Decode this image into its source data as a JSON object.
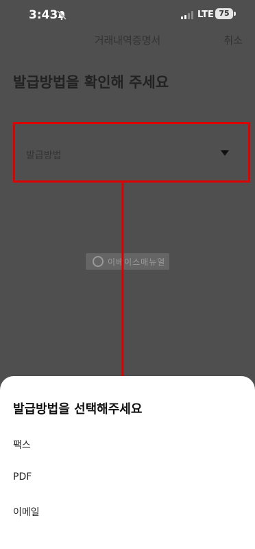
{
  "status_bar": {
    "time": "3:43",
    "network": "LTE",
    "battery": "75",
    "icons": [
      "bell-off-icon",
      "signal-icon",
      "battery-icon"
    ]
  },
  "header": {
    "title": "거래내역증명서",
    "cancel_label": "취소"
  },
  "main": {
    "heading": "발급방법을 확인해 주세요",
    "select": {
      "placeholder": "발급방법",
      "icon": "caret-down-icon"
    },
    "watermark": "이베이스매뉴얼"
  },
  "sheet": {
    "title": "발급방법을 선택해주세요",
    "options": [
      {
        "label": "팩스"
      },
      {
        "label": "PDF"
      },
      {
        "label": "이메일"
      }
    ]
  },
  "colors": {
    "overlay": "#4f4f4f",
    "highlight": "#e00000",
    "sheet_background": "#ffffff"
  }
}
